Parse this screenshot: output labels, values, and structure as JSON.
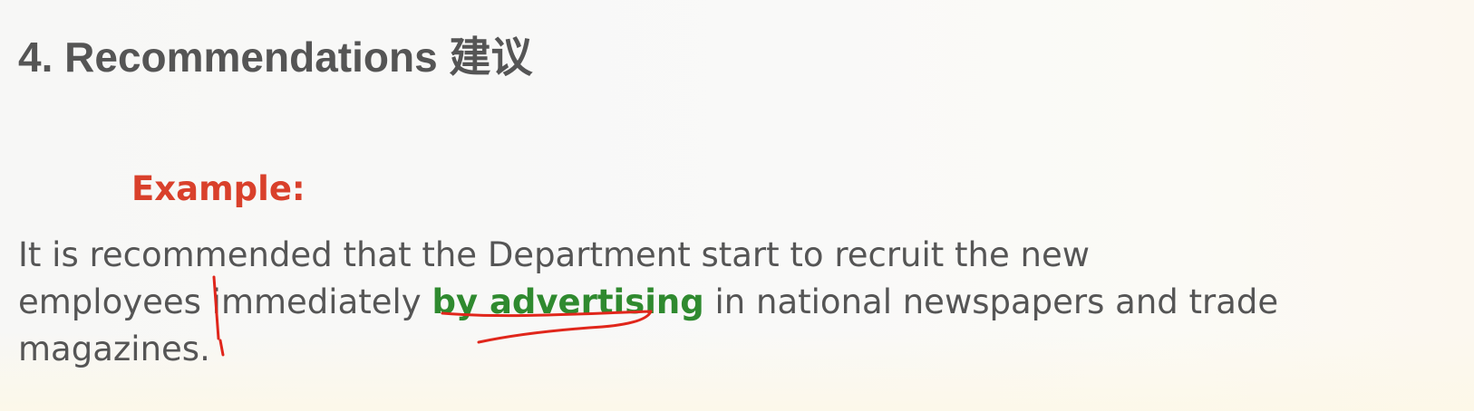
{
  "heading": "4. Recommendations 建议",
  "example_label": "Example:",
  "paragraph": {
    "line1": "It is recommended that the Department start to recruit the new",
    "line2_before": "employees immediately ",
    "line2_highlight": "by advertising",
    "line2_after": " in national newspapers and trade",
    "line3": "magazines."
  },
  "colors": {
    "heading_text": "#555555",
    "example_label": "#d9402b",
    "body_text": "#555555",
    "highlight": "#2f8a2f",
    "annotation_ink": "#e0261b"
  }
}
